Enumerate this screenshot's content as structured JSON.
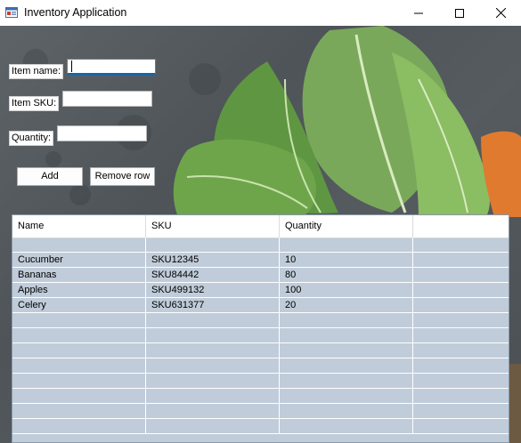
{
  "window": {
    "title": "Inventory Application",
    "icons": {
      "app": "app-form-icon",
      "minimize": "minimize-icon",
      "maximize": "maximize-icon",
      "close": "close-icon"
    }
  },
  "form": {
    "item_name_label": "Item name:",
    "item_name_value": "",
    "item_sku_label": "Item SKU:",
    "item_sku_value": "",
    "quantity_label": "Quantity:",
    "quantity_value": "",
    "add_button": "Add",
    "remove_button": "Remove row"
  },
  "grid": {
    "columns": [
      "Name",
      "SKU",
      "Quantity",
      ""
    ],
    "rows": [
      [
        "",
        "",
        "",
        ""
      ],
      [
        "Cucumber",
        "SKU12345",
        "10",
        ""
      ],
      [
        "Bananas",
        "SKU84442",
        "80",
        ""
      ],
      [
        "Apples",
        "SKU499132",
        "100",
        ""
      ],
      [
        "Celery",
        "SKU631377",
        "20",
        ""
      ],
      [
        "",
        "",
        "",
        ""
      ],
      [
        "",
        "",
        "",
        ""
      ],
      [
        "",
        "",
        "",
        ""
      ],
      [
        "",
        "",
        "",
        ""
      ],
      [
        "",
        "",
        "",
        ""
      ],
      [
        "",
        "",
        "",
        ""
      ],
      [
        "",
        "",
        "",
        ""
      ],
      [
        "",
        "",
        "",
        ""
      ]
    ],
    "colors": {
      "row_bg": "#c0ccd9",
      "header_bg": "#ffffff"
    }
  }
}
